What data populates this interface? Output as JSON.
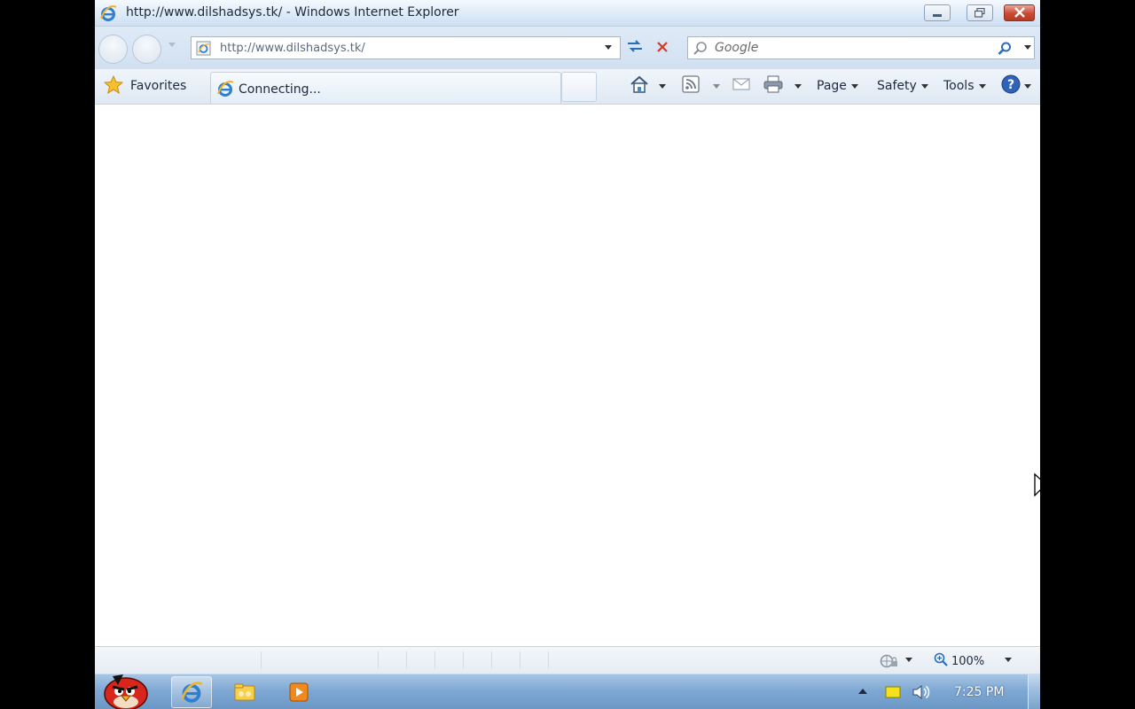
{
  "window": {
    "title": "http://www.dilshadsys.tk/ - Windows Internet Explorer"
  },
  "address_bar": {
    "url": "http://www.dilshadsys.tk/"
  },
  "search": {
    "placeholder": "Google"
  },
  "command_bar": {
    "favorites_label": "Favorites",
    "page_label": "Page",
    "safety_label": "Safety",
    "tools_label": "Tools"
  },
  "tab": {
    "title": "Connecting..."
  },
  "status_bar": {
    "zoom": "100%"
  },
  "taskbar": {
    "clock": "7:25 PM"
  },
  "icons": {
    "ie": "internet-explorer-icon",
    "favorites": "star-icon",
    "home": "home-icon",
    "feeds": "rss-feed-icon",
    "mail": "read-mail-icon",
    "print": "printer-icon",
    "help": "help-icon",
    "search": "magnifier-icon",
    "refresh": "refresh-icon",
    "stop": "stop-icon"
  },
  "colors": {
    "close_button": "#c94a34",
    "taskbar": "#7fa9d4",
    "accent_blue": "#2a6ebb"
  }
}
